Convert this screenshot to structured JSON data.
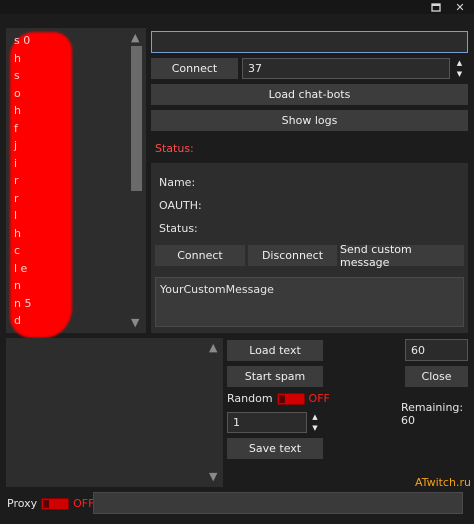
{
  "window": {
    "restore_icon": "restore-icon",
    "close_glyph": "✕"
  },
  "bots_list": {
    "items": [
      "s 0",
      "h",
      "s",
      "o",
      "h",
      "f",
      "j",
      "i",
      "r",
      "r",
      "l",
      "h",
      "c",
      "l e",
      "n",
      "n 5",
      "d"
    ]
  },
  "token_input": {
    "value": ""
  },
  "connect_button": "Connect",
  "count_spinner": {
    "value": "37"
  },
  "load_bots_button": "Load chat-bots",
  "show_logs_button": "Show logs",
  "status_label": "Status:",
  "info": {
    "name_label": "Name:",
    "oauth_label": "OAUTH:",
    "status_label": "Status:"
  },
  "bot_actions": {
    "connect": "Connect",
    "disconnect": "Disconnect",
    "send_custom": "Send custom message"
  },
  "custom_message": {
    "value": "YourCustomMessage"
  },
  "spam": {
    "load_text": "Load text",
    "start_spam": "Start spam",
    "random_label": "Random",
    "random_state": "OFF",
    "repeat_value": "1",
    "save_text": "Save text",
    "interval_value": "60",
    "close": "Close",
    "remaining": "Remaining: 60"
  },
  "watermark": "ATwitch.ru",
  "proxy": {
    "label": "Proxy",
    "state": "OFF",
    "value": ""
  },
  "colors": {
    "background": "#1c1c1c",
    "panel": "#2d2d2d",
    "button": "#3c3c3c",
    "status_red": "#ff4a4a",
    "toggle_red": "#d00000",
    "watermark_orange": "#f3a21b",
    "focus_border": "#7a9fd8"
  }
}
